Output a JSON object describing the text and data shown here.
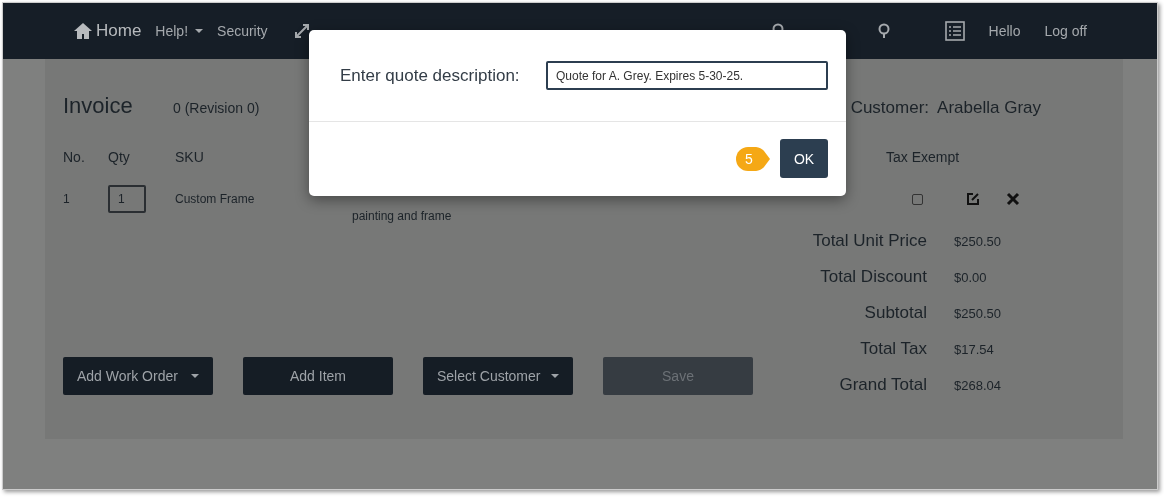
{
  "nav": {
    "left": [
      {
        "kind": "home",
        "label": "Home"
      },
      {
        "kind": "dropdown",
        "label": "Help!"
      },
      {
        "kind": "link",
        "label": "Security"
      },
      {
        "kind": "fullscreen"
      }
    ],
    "right": [
      {
        "kind": "search"
      },
      {
        "kind": "search"
      },
      {
        "kind": "list"
      },
      {
        "kind": "text",
        "label": "Hello"
      },
      {
        "kind": "link",
        "label": "Log off"
      }
    ]
  },
  "invoice": {
    "title": "Invoice",
    "number": "0 (Revision 0)",
    "customer_label": "Customer:",
    "customer_name": "Arabella Gray",
    "columns": [
      "No.",
      "Qty",
      "SKU",
      "Tax Exempt"
    ],
    "rows": [
      {
        "no": "1",
        "qty": "1",
        "sku": "Custom Frame",
        "description": "painting and frame",
        "tax_exempt": false
      }
    ],
    "totals": [
      {
        "label": "Total Unit Price",
        "value": "$250.50"
      },
      {
        "label": "Total Discount",
        "value": "$0.00"
      },
      {
        "label": "Subtotal",
        "value": "$250.50"
      },
      {
        "label": "Total Tax",
        "value": "$17.54"
      },
      {
        "label": "Grand Total",
        "value": "$268.04"
      }
    ],
    "buttons": [
      {
        "label": "Add Work Order",
        "dropdown": true,
        "disabled": false
      },
      {
        "label": "Add Item",
        "dropdown": false,
        "disabled": false
      },
      {
        "label": "Select Customer",
        "dropdown": true,
        "disabled": false
      },
      {
        "label": "Save",
        "dropdown": false,
        "disabled": true
      }
    ]
  },
  "dialog": {
    "label": "Enter quote description:",
    "value": "Quote for A. Grey. Expires 5-30-25.",
    "ok": "OK",
    "step": "5"
  }
}
